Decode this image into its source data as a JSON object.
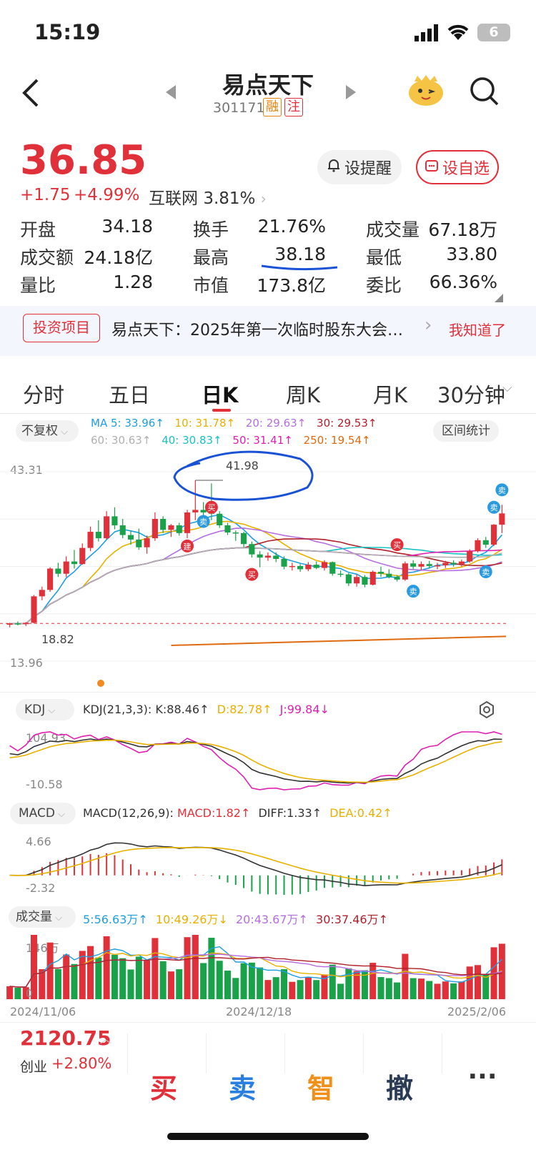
{
  "status_bar": {
    "time": "15:19",
    "battery": "6"
  },
  "header": {
    "stock_name": "易点天下",
    "stock_code": "301171",
    "badge_rong": "融",
    "badge_zhu": "注"
  },
  "quote": {
    "price": "36.85",
    "change": "+1.75",
    "change_pct": "+4.99%",
    "sector": "互联网",
    "sector_pct": "3.81%",
    "remind_label": "设提醒",
    "watch_label": "设自选"
  },
  "stats": [
    [
      {
        "label": "开盘",
        "value": "34.18",
        "color": "green"
      },
      {
        "label": "换手",
        "value": "21.76%",
        "color": "black"
      },
      {
        "label": "成交量",
        "value": "67.18万",
        "color": "black"
      }
    ],
    [
      {
        "label": "成交额",
        "value": "24.18亿",
        "color": "black"
      },
      {
        "label": "最高",
        "value": "38.18",
        "color": "red"
      },
      {
        "label": "最低",
        "value": "33.80",
        "color": "green"
      }
    ],
    [
      {
        "label": "量比",
        "value": "1.28",
        "color": "black"
      },
      {
        "label": "市值",
        "value": "173.8亿",
        "color": "black"
      },
      {
        "label": "委比",
        "value": "66.36%",
        "color": "red"
      }
    ]
  ],
  "notice": {
    "tag": "投资项目",
    "text": "易点天下：2025年第一次临时股东大会…",
    "dismiss": "我知道了"
  },
  "period_tabs": [
    "分时",
    "五日",
    "日K",
    "周K",
    "月K",
    "30分钟"
  ],
  "active_tab": "日K",
  "chart_controls": {
    "adjust": "不复权",
    "range_stats": "区间统计"
  },
  "ma_legend": [
    {
      "label": "MA 5: 33.96↑",
      "color": "#1e9fe0"
    },
    {
      "label": "10: 31.78↑",
      "color": "#e8b100"
    },
    {
      "label": "20: 29.63↑",
      "color": "#b56ee0"
    },
    {
      "label": "30: 29.53↑",
      "color": "#b0202a"
    },
    {
      "label": "60: 30.63↑",
      "color": "#b0b0b0"
    },
    {
      "label": "40: 30.83↑",
      "color": "#19c2c2"
    },
    {
      "label": "50: 31.41↑",
      "color": "#e020b0"
    },
    {
      "label": "250: 19.54↑",
      "color": "#e06a10"
    }
  ],
  "chart_labels": {
    "y_max": "43.31",
    "y_min": "13.96",
    "peak": "41.98",
    "low": "18.82",
    "marks": {
      "buy": "买",
      "sell": "卖",
      "build": "建"
    }
  },
  "chart_data": {
    "type": "candlestick",
    "y_range": [
      13.96,
      43.31
    ],
    "candles": [
      [
        19.6,
        19.9,
        19.2,
        19.8
      ],
      [
        19.8,
        20.1,
        19.5,
        19.7
      ],
      [
        19.7,
        20.0,
        19.4,
        19.9
      ],
      [
        19.9,
        24.2,
        19.8,
        24.0
      ],
      [
        24.0,
        25.5,
        23.4,
        25.0
      ],
      [
        25.0,
        28.5,
        24.7,
        28.3
      ],
      [
        28.3,
        29.2,
        27.0,
        27.5
      ],
      [
        27.5,
        30.2,
        27.0,
        29.4
      ],
      [
        29.4,
        31.2,
        28.3,
        29.0
      ],
      [
        29.0,
        32.2,
        28.9,
        31.5
      ],
      [
        31.5,
        34.8,
        31.0,
        34.0
      ],
      [
        34.0,
        35.8,
        32.5,
        33.0
      ],
      [
        33.0,
        37.2,
        32.8,
        36.4
      ],
      [
        36.4,
        37.8,
        34.4,
        35.0
      ],
      [
        35.0,
        36.0,
        33.0,
        33.5
      ],
      [
        33.5,
        34.2,
        32.0,
        32.8
      ],
      [
        32.8,
        34.5,
        31.2,
        31.6
      ],
      [
        31.6,
        33.4,
        30.6,
        33.0
      ],
      [
        33.0,
        37.0,
        32.6,
        36.0
      ],
      [
        36.0,
        36.4,
        33.8,
        34.3
      ],
      [
        34.3,
        35.2,
        33.2,
        35.0
      ],
      [
        35.0,
        35.4,
        33.4,
        33.8
      ],
      [
        33.8,
        37.4,
        33.0,
        37.0
      ],
      [
        37.0,
        41.98,
        35.8,
        37.4
      ],
      [
        37.4,
        38.6,
        35.6,
        37.0
      ],
      [
        37.0,
        41.5,
        35.8,
        36.8
      ],
      [
        36.8,
        37.2,
        34.6,
        35.0
      ],
      [
        35.0,
        35.4,
        33.5,
        33.9
      ],
      [
        33.9,
        34.2,
        32.6,
        33.8
      ],
      [
        33.8,
        34.0,
        31.6,
        32.1
      ],
      [
        32.1,
        32.5,
        30.0,
        30.5
      ],
      [
        30.5,
        31.0,
        28.5,
        30.0
      ],
      [
        30.0,
        30.8,
        29.5,
        30.3
      ],
      [
        30.3,
        30.8,
        29.3,
        29.8
      ],
      [
        29.8,
        30.2,
        28.2,
        28.6
      ],
      [
        28.6,
        29.2,
        28.0,
        28.7
      ],
      [
        28.7,
        29.0,
        27.8,
        28.2
      ],
      [
        28.2,
        29.3,
        27.9,
        28.9
      ],
      [
        28.9,
        29.4,
        28.2,
        28.4
      ],
      [
        28.4,
        29.6,
        28.0,
        29.3
      ],
      [
        29.3,
        29.4,
        27.2,
        27.5
      ],
      [
        27.5,
        28.0,
        27.0,
        27.4
      ],
      [
        27.4,
        27.6,
        25.6,
        26.0
      ],
      [
        26.0,
        27.4,
        25.5,
        27.0
      ],
      [
        27.0,
        27.3,
        25.4,
        25.8
      ],
      [
        25.8,
        28.0,
        25.7,
        27.8
      ],
      [
        27.8,
        28.6,
        27.0,
        27.5
      ],
      [
        27.5,
        28.2,
        26.8,
        27.0
      ],
      [
        27.0,
        27.3,
        26.3,
        26.6
      ],
      [
        26.6,
        29.4,
        26.4,
        29.1
      ],
      [
        29.1,
        29.6,
        28.2,
        28.6
      ],
      [
        28.6,
        29.4,
        28.0,
        29.0
      ],
      [
        29.0,
        29.5,
        28.3,
        28.7
      ],
      [
        28.7,
        29.2,
        28.2,
        28.8
      ],
      [
        28.8,
        29.5,
        28.4,
        29.2
      ],
      [
        29.2,
        29.6,
        28.6,
        29.0
      ],
      [
        29.0,
        29.7,
        28.6,
        29.4
      ],
      [
        29.4,
        31.3,
        29.2,
        31.0
      ],
      [
        31.0,
        33.0,
        30.8,
        32.7
      ],
      [
        32.7,
        33.2,
        31.5,
        32.0
      ],
      [
        32.0,
        35.2,
        31.8,
        35.1
      ],
      [
        35.1,
        38.18,
        33.8,
        36.85
      ]
    ],
    "x_labels": [
      "2024/11/06",
      "2024/12/18",
      "2025/2/06"
    ]
  },
  "kdj": {
    "selector": "KDJ",
    "params": "KDJ(21,3,3):",
    "k": "K:88.46↑",
    "d": "D:82.78↑",
    "j": "J:99.84↓",
    "top": "104.93",
    "bottom": "-10.58"
  },
  "macd": {
    "selector": "MACD",
    "params": "MACD(12,26,9):",
    "macd": "MACD:1.82↑",
    "diff": "DIFF:1.33↑",
    "dea": "DEA:0.42↑",
    "top": "4.66",
    "bottom": "-2.32"
  },
  "volume": {
    "selector": "成交量",
    "ma5": "5:56.63万↑",
    "ma10": "10:49.26万↓",
    "ma20": "20:43.67万↑",
    "ma30": "30:37.46万↑",
    "top": "146万",
    "bottom": "0"
  },
  "index": {
    "value": "2120.75",
    "name": "创业",
    "pct": "+2.80%"
  },
  "actions": {
    "buy": "买",
    "sell": "卖",
    "smart": "智",
    "cancel": "撤",
    "more": "···"
  }
}
